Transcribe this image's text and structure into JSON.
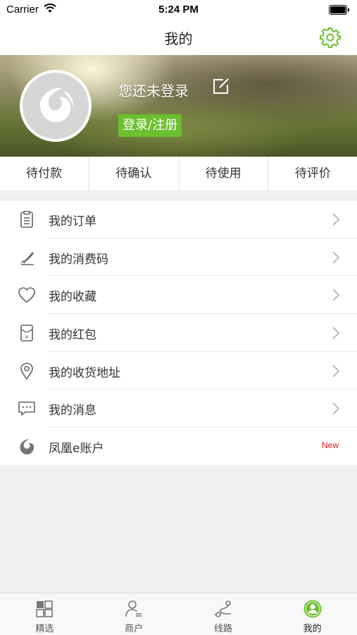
{
  "status_bar": {
    "carrier": "Carrier",
    "time": "5:24 PM"
  },
  "nav": {
    "title": "我的",
    "settings_icon": "gear-icon"
  },
  "profile": {
    "login_hint": "您还未登录",
    "login_button": "登录/注册",
    "edit_icon": "edit-icon",
    "avatar_icon": "phoenix-logo-icon"
  },
  "order_tabs": [
    {
      "label": "待付款"
    },
    {
      "label": "待确认"
    },
    {
      "label": "待使用"
    },
    {
      "label": "待评价"
    }
  ],
  "menu": [
    {
      "label": "我的订单",
      "icon": "clipboard-icon"
    },
    {
      "label": "我的消费码",
      "icon": "code-icon"
    },
    {
      "label": "我的收藏",
      "icon": "heart-icon"
    },
    {
      "label": "我的红包",
      "icon": "red-envelope-icon"
    },
    {
      "label": "我的收货地址",
      "icon": "location-pin-icon"
    },
    {
      "label": "我的消息",
      "icon": "message-icon"
    },
    {
      "label": "凤凰e账户",
      "icon": "phoenix-icon",
      "badge": "New"
    }
  ],
  "tab_bar": [
    {
      "label": "精选",
      "icon": "grid-icon"
    },
    {
      "label": "商户",
      "icon": "merchant-icon"
    },
    {
      "label": "线路",
      "icon": "route-icon"
    },
    {
      "label": "我的",
      "icon": "profile-icon",
      "active": true
    }
  ],
  "colors": {
    "accent": "#6cbf2f",
    "badge": "#e0141e",
    "background": "#f0f0f0"
  }
}
